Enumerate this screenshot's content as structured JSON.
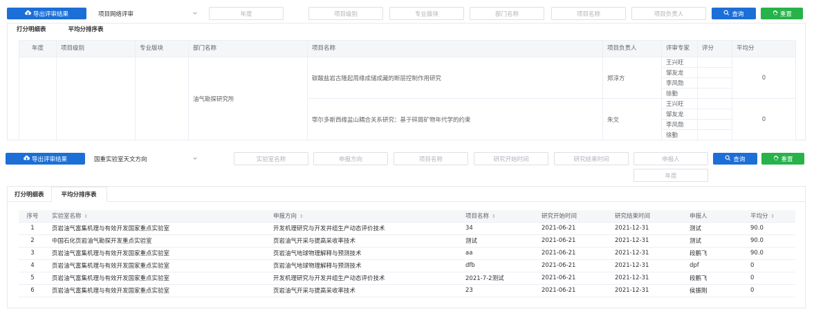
{
  "section1": {
    "export_label": "导出评审结果",
    "select_value": "项目网络评审",
    "filters": [
      "年度",
      "项目级别",
      "专业版块",
      "部门名称",
      "项目名称",
      "项目负责人"
    ],
    "query_label": "查询",
    "reset_label": "重置",
    "tabs": [
      "打分明细表",
      "平均分排序表"
    ],
    "table": {
      "headers": [
        "年度",
        "项目级别",
        "专业版块",
        "部门名称",
        "项目名称",
        "项目负责人",
        "评审专家",
        "评分",
        "平均分"
      ],
      "department": "油气勘探研究所",
      "projects": [
        {
          "name": "碳酸盐岩古隆起周缘成储成藏的断层控制作用研究",
          "leader": "郑淳方",
          "experts": [
            "王兴旺",
            "邹友龙",
            "李凤勋",
            "徐勤"
          ],
          "average": "0"
        },
        {
          "name": "鄂尔多斯西缘盆山耦合关系研究：基于碎屑矿物年代学的约束",
          "leader": "朱文",
          "experts": [
            "王兴旺",
            "邹友龙",
            "李凤勋",
            "徐勤"
          ],
          "average": "0"
        }
      ]
    }
  },
  "section2": {
    "export_label": "导出评审结果",
    "select_value": "国重实验室天文方向",
    "filters": [
      "实验室名称",
      "申报方向",
      "项目名称",
      "研究开始时间",
      "研究结束时间",
      "申报人",
      "年度"
    ],
    "query_label": "查询",
    "reset_label": "重置",
    "tabs": [
      "打分明细表",
      "平均分排序表"
    ],
    "table": {
      "headers": [
        "序号",
        "实验室名称",
        "申报方向",
        "项目名称",
        "研究开始时间",
        "研究结束时间",
        "申报人",
        "平均分"
      ],
      "sort_icon": "⇕",
      "rows": [
        [
          "1",
          "页岩油气富集机理与有效开发国家重点实验室",
          "开发机理研究与开发井组生产动态评价技术",
          "34",
          "2021-06-21",
          "2021-12-31",
          "测试",
          "90.0"
        ],
        [
          "2",
          "中国石化页岩油气勘探开发重点实验室",
          "页岩油气开采与提高采收率技术",
          "测试",
          "2021-06-21",
          "2021-12-31",
          "测试",
          "90.0"
        ],
        [
          "3",
          "页岩油气富集机理与有效开发国家重点实验室",
          "页岩油气地球物理解释与预测技术",
          "aa",
          "2021-06-21",
          "2021-12-31",
          "段鹏飞",
          "90.0"
        ],
        [
          "4",
          "页岩油气富集机理与有效开发国家重点实验室",
          "页岩油气地球物理解释与预测技术",
          "dfb",
          "2021-06-21",
          "2021-12-31",
          "dpf",
          "0"
        ],
        [
          "5",
          "页岩油气富集机理与有效开发国家重点实验室",
          "开发机理研究与开发井组生产动态评价技术",
          "2021-7-2测试",
          "2021-06-21",
          "2021-12-31",
          "段鹏飞",
          "0"
        ],
        [
          "6",
          "页岩油气富集机理与有效开发国家重点实验室",
          "页岩油气开采与提高采收率技术",
          "23",
          "2021-06-21",
          "2021-12-31",
          "侯振刚",
          "0"
        ]
      ]
    }
  }
}
